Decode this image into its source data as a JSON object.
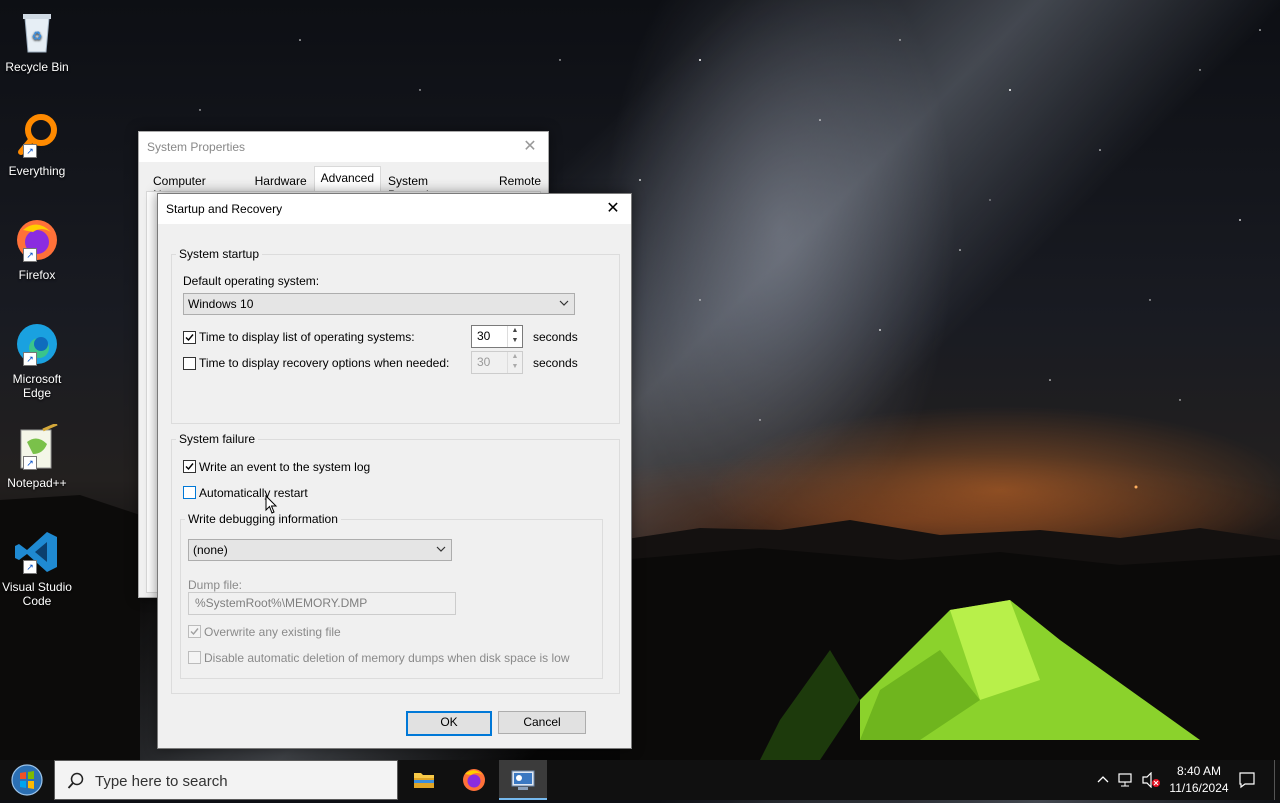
{
  "desktop": {
    "icons": [
      {
        "label": "Recycle Bin",
        "icon": "recycle-bin-icon"
      },
      {
        "label": "Everything",
        "icon": "everything-search-icon"
      },
      {
        "label": "Firefox",
        "icon": "firefox-icon"
      },
      {
        "label": "Microsoft Edge",
        "icon": "edge-icon"
      },
      {
        "label": "Notepad++",
        "icon": "notepadpp-icon"
      },
      {
        "label": "Visual Studio Code",
        "icon": "vscode-icon"
      }
    ]
  },
  "system_properties": {
    "title": "System Properties",
    "tabs": [
      "Computer Name",
      "Hardware",
      "Advanced",
      "System Protection",
      "Remote"
    ],
    "active_tab": "Advanced"
  },
  "dialog": {
    "title": "Startup and Recovery",
    "system_startup": {
      "group_label": "System startup",
      "default_os_label": "Default operating system:",
      "default_os_value": "Windows 10",
      "display_list": {
        "label": "Time to display list of operating systems:",
        "checked": true,
        "value": "30",
        "unit": "seconds"
      },
      "display_recovery": {
        "label": "Time to display recovery options when needed:",
        "checked": false,
        "value": "30",
        "unit": "seconds"
      }
    },
    "system_failure": {
      "group_label": "System failure",
      "write_event": {
        "label": "Write an event to the system log",
        "checked": true
      },
      "auto_restart": {
        "label": "Automatically restart",
        "checked": false
      },
      "debug_group_label": "Write debugging information",
      "debug_value": "(none)",
      "dump_file_label": "Dump file:",
      "dump_file_value": "%SystemRoot%\\MEMORY.DMP",
      "overwrite": {
        "label": "Overwrite any existing file",
        "checked": true,
        "disabled": true
      },
      "disable_auto_delete": {
        "label": "Disable automatic deletion of memory dumps when disk space is low",
        "checked": false,
        "disabled": true
      }
    },
    "ok_label": "OK",
    "cancel_label": "Cancel"
  },
  "taskbar": {
    "search_placeholder": "Type here to search",
    "time": "8:40 AM",
    "date": "11/16/2024",
    "apps": [
      "file-explorer-icon",
      "firefox-icon",
      "system-properties-icon"
    ],
    "active_app": "system-properties-icon"
  }
}
